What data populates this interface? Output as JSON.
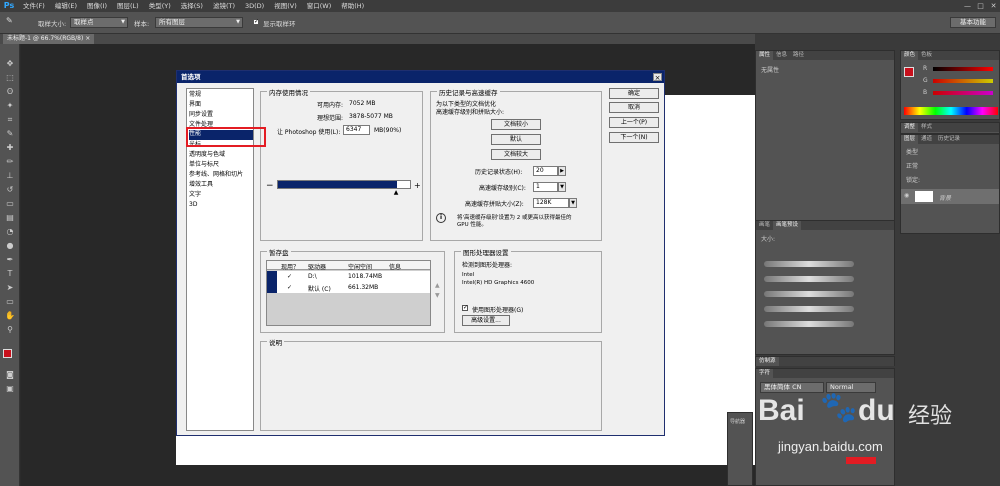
{
  "app": {
    "logo": "Ps",
    "menu": [
      "文件(F)",
      "编辑(E)",
      "图像(I)",
      "图层(L)",
      "类型(Y)",
      "选择(S)",
      "滤镜(T)",
      "3D(D)",
      "视图(V)",
      "窗口(W)",
      "帮助(H)"
    ],
    "window_controls": [
      "—",
      "□",
      "✕"
    ]
  },
  "options_bar": {
    "sample_size_label": "取样大小:",
    "sample_size_value": "取样点",
    "sample_label": "样本:",
    "sample_value": "所有图层",
    "show_ring_label": "显示取样环",
    "workspace_label": "基本功能"
  },
  "document": {
    "tab_label": "未标题-1 @ 66.7%(RGB/8)"
  },
  "right_panels": {
    "properties_tabs": [
      "属性",
      "信息",
      "路径"
    ],
    "properties_empty": "无属性",
    "color_tabs": [
      "颜色",
      "色板"
    ],
    "color_slider_labels": [
      "R",
      "G",
      "B"
    ],
    "adjust_tabs": [
      "调整",
      "样式"
    ],
    "layers_tabs": [
      "图层",
      "通道",
      "历史记录"
    ],
    "layers_kind": "类型",
    "layers_blend": "正常",
    "layers_lock": "锁定:",
    "layer_name": "背景",
    "brush_tabs": [
      "画笔",
      "画笔预设"
    ],
    "brush_size_label": "大小:",
    "char_style_tabs": [
      "仿制源"
    ],
    "char_tabs": [
      "字符"
    ],
    "font_family": "黑体简体 CN",
    "font_style": "Normal",
    "navigator_label": "导航器"
  },
  "dialog": {
    "title": "首选项",
    "close_icon": "close-icon",
    "categories": [
      "常规",
      "界面",
      "同步设置",
      "文件处理",
      "性能",
      "光标",
      "透明度与色域",
      "单位与标尺",
      "参考线、网格和切片",
      "增效工具",
      "文字",
      "3D"
    ],
    "selected_category": "性能",
    "buttons": {
      "ok": "确定",
      "cancel": "取消",
      "prev": "上一个(P)",
      "next": "下一个(N)"
    },
    "memory": {
      "title": "内存使用情况",
      "available_label": "可用内存:",
      "available_value": "7052 MB",
      "ideal_label": "理想范围:",
      "ideal_value": "3878-5077 MB",
      "let_ps_use_label": "让 Photoshop 使用(L):",
      "let_ps_use_value": "6347",
      "let_ps_use_unit": "MB(90%)",
      "minus": "−",
      "plus": "+",
      "usage_percent": 90
    },
    "history": {
      "title": "历史记录与高速缓存",
      "desc_line1": "为以下类型的文档优化",
      "desc_line2": "高速缓存级别和拼贴大小:",
      "btn_tall_thin": "文档较小",
      "btn_default": "默认",
      "btn_big_flat": "文档较大",
      "history_states_label": "历史记录状态(H):",
      "history_states_value": "20",
      "cache_levels_label": "高速缓存级别(C):",
      "cache_levels_value": "1",
      "tile_size_label": "高速缓存拼贴大小(Z):",
      "tile_size_value": "128K",
      "note_line1": "将'高速缓存级别'设置为 2 或更高以获得最佳的",
      "note_line2": "GPU 性能。"
    },
    "scratch": {
      "title": "暂存盘",
      "headers": [
        "现用？",
        "驱动器",
        "空闲空间",
        "信息"
      ],
      "rows": [
        {
          "active": "✓",
          "drive": "D:\\",
          "free": "1018.74MB",
          "info": ""
        },
        {
          "active": "✓",
          "drive": "默认 (C)",
          "free": "661.32MB",
          "info": ""
        }
      ]
    },
    "gpu": {
      "title": "图形处理器设置",
      "detected_label": "检测到图形处理器:",
      "vendor": "Intel",
      "model": "Intel(R) HD Graphics 4600",
      "use_gpu_label": "使用图形处理器(G)",
      "advanced_btn": "高级设置..."
    },
    "description": {
      "title": "说明"
    }
  },
  "watermark": {
    "brand": "Bai",
    "brand2": "du",
    "cn": "经验",
    "url": "jingyan.baidu.com"
  }
}
